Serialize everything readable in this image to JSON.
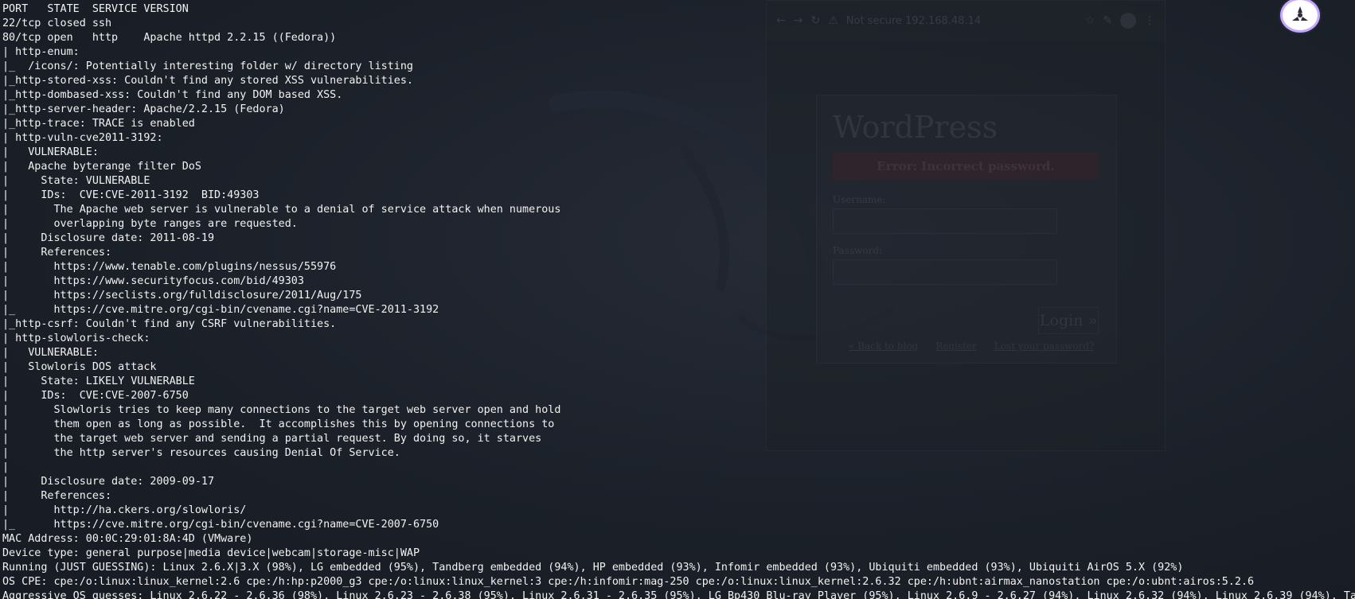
{
  "terminal": {
    "lines": [
      "PORT   STATE  SERVICE VERSION",
      "22/tcp closed ssh",
      "80/tcp open   http    Apache httpd 2.2.15 ((Fedora))",
      "| http-enum:",
      "|_  /icons/: Potentially interesting folder w/ directory listing",
      "|_http-stored-xss: Couldn't find any stored XSS vulnerabilities.",
      "|_http-dombased-xss: Couldn't find any DOM based XSS.",
      "|_http-server-header: Apache/2.2.15 (Fedora)",
      "|_http-trace: TRACE is enabled",
      "| http-vuln-cve2011-3192:",
      "|   VULNERABLE:",
      "|   Apache byterange filter DoS",
      "|     State: VULNERABLE",
      "|     IDs:  CVE:CVE-2011-3192  BID:49303",
      "|       The Apache web server is vulnerable to a denial of service attack when numerous",
      "|       overlapping byte ranges are requested.",
      "|     Disclosure date: 2011-08-19",
      "|     References:",
      "|       https://www.tenable.com/plugins/nessus/55976",
      "|       https://www.securityfocus.com/bid/49303",
      "|       https://seclists.org/fulldisclosure/2011/Aug/175",
      "|_      https://cve.mitre.org/cgi-bin/cvename.cgi?name=CVE-2011-3192",
      "|_http-csrf: Couldn't find any CSRF vulnerabilities.",
      "| http-slowloris-check:",
      "|   VULNERABLE:",
      "|   Slowloris DOS attack",
      "|     State: LIKELY VULNERABLE",
      "|     IDs:  CVE:CVE-2007-6750",
      "|       Slowloris tries to keep many connections to the target web server open and hold",
      "|       them open as long as possible.  It accomplishes this by opening connections to",
      "|       the target web server and sending a partial request. By doing so, it starves",
      "|       the http server's resources causing Denial Of Service.",
      "|",
      "|     Disclosure date: 2009-09-17",
      "|     References:",
      "|       http://ha.ckers.org/slowloris/",
      "|_      https://cve.mitre.org/cgi-bin/cvename.cgi?name=CVE-2007-6750",
      "MAC Address: 00:0C:29:01:8A:4D (VMware)",
      "Device type: general purpose|media device|webcam|storage-misc|WAP",
      "Running (JUST GUESSING): Linux 2.6.X|3.X (98%), LG embedded (95%), Tandberg embedded (94%), HP embedded (93%), Infomir embedded (93%), Ubiquiti embedded (93%), Ubiquiti AirOS 5.X (92%)",
      "OS CPE: cpe:/o:linux:linux_kernel:2.6 cpe:/h:hp:p2000_g3 cpe:/o:linux:linux_kernel:3 cpe:/h:infomir:mag-250 cpe:/o:linux:linux_kernel:2.6.32 cpe:/h:ubnt:airmax_nanostation cpe:/o:ubnt:airos:5.2.6",
      "Aggressive OS guesses: Linux 2.6.22 - 2.6.36 (98%), Linux 2.6.23 - 2.6.38 (95%), Linux 2.6.31 - 2.6.35 (95%), LG Bp430 Blu-ray Player (95%), Linux 2.6.9 - 2.6.27 (94%), Linux 2.6.32 (94%), Linux 2.6.39 (94%), Tan"
    ]
  },
  "ghost_browser": {
    "url": "Not secure  192.168.48.14",
    "page": {
      "title": "WordPress",
      "error": "Error: Incorrect password.",
      "username_label": "Username:",
      "password_label": "Password:",
      "login_button": "Login »",
      "links": [
        "« Back to blog",
        "Register",
        "Lost your password?"
      ]
    }
  },
  "colors": {
    "background": "#1a1f29",
    "terminal_text": "#f2f2f2",
    "icon_ring": "#c9a7ff"
  }
}
